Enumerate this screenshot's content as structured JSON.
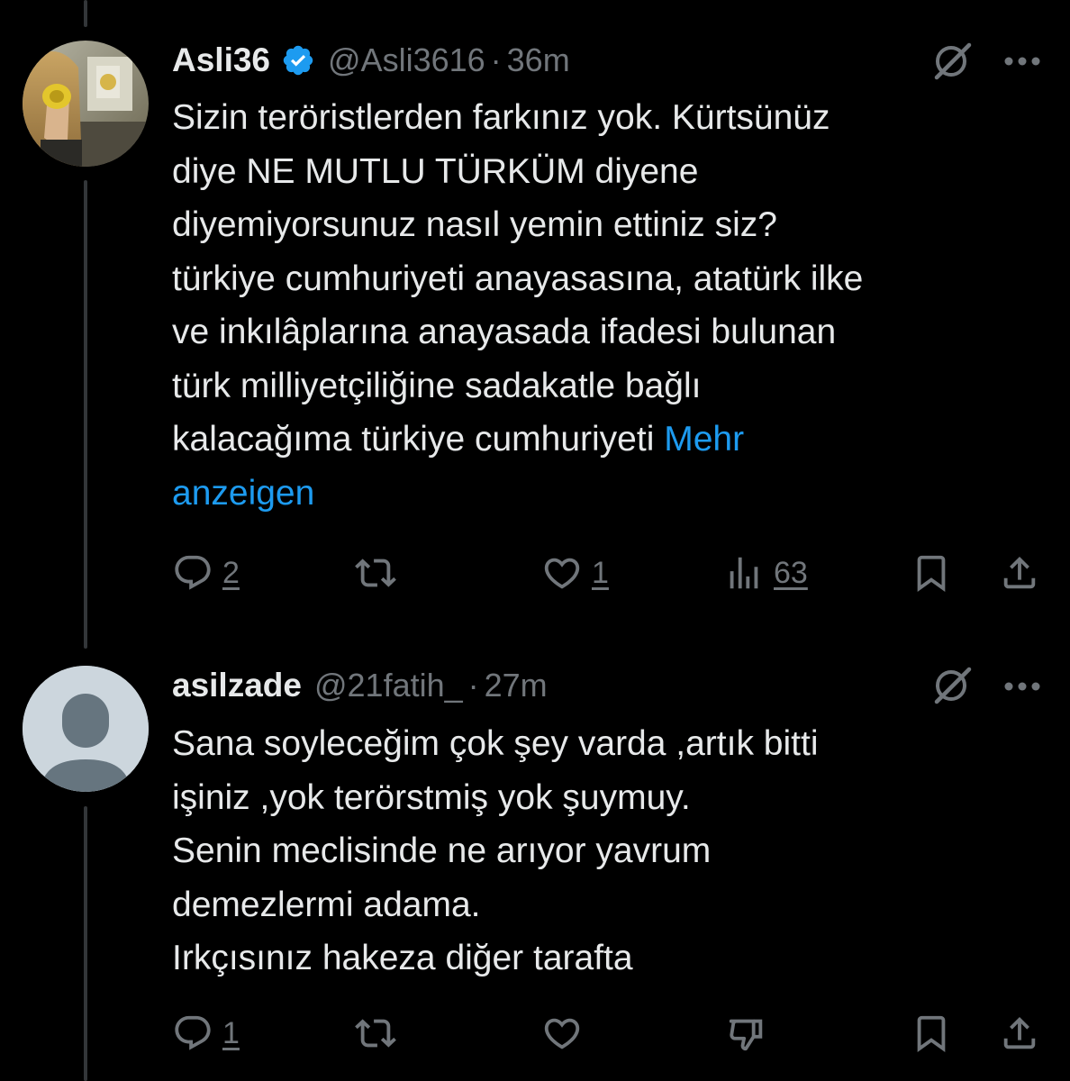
{
  "tweets": [
    {
      "display_name": "Asli36",
      "verified": true,
      "handle": "@Asli3616",
      "separator": "·",
      "time": "36m",
      "lines": [
        "Sizin teröristlerden farkınız yok. Kürtsünüz",
        "diye NE MUTLU TÜRKÜM diyene",
        "diyemiyorsunuz nasıl yemin ettiniz siz?",
        "türkiye cumhuriyeti anayasasına, atatürk ilke",
        "ve inkılâplarına anayasada ifadesi bulunan",
        "türk milliyetçiliğine sadakatle bağlı",
        "kalacağıma türkiye cumhuriyeti "
      ],
      "show_more_line1": "Mehr",
      "show_more_line2": "anzeigen",
      "actions": {
        "replies": "2",
        "retweets": "",
        "likes": "1",
        "views": "63"
      },
      "icons": [
        "grok-icon",
        "more-icon",
        "reply-icon",
        "retweet-icon",
        "like-icon",
        "views-icon",
        "bookmark-icon",
        "share-icon",
        "verified-badge-icon"
      ]
    },
    {
      "display_name": "asilzade",
      "verified": false,
      "handle": "@21fatih_",
      "separator": "·",
      "time": "27m",
      "lines": [
        "Sana soyleceğim çok şey varda ,artık bitti",
        "işiniz ,yok terörstmiş yok şuymuy.",
        "Senin meclisinde ne arıyor yavrum",
        "demezlermi adama.",
        "Irkçısınız hakeza diğer tarafta"
      ],
      "actions": {
        "replies": "1",
        "retweets": "",
        "likes": ""
      },
      "icons": [
        "grok-icon",
        "more-icon",
        "reply-icon",
        "retweet-icon",
        "like-icon",
        "dislike-icon",
        "bookmark-icon",
        "share-icon",
        "default-avatar-icon"
      ]
    }
  ],
  "colors": {
    "background": "#000000",
    "text_primary": "#e7e9ea",
    "text_secondary": "#71767b",
    "accent_blue": "#1d9bf0",
    "thread_line": "#333639"
  }
}
